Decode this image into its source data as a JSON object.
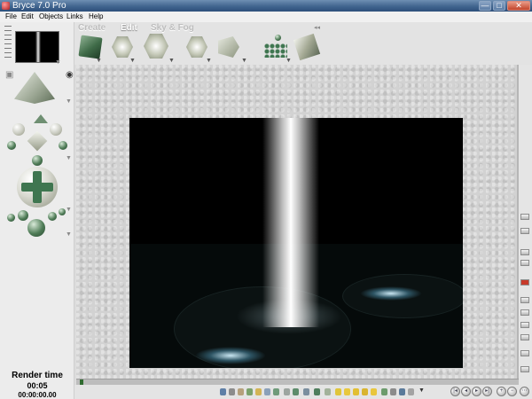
{
  "window": {
    "title": "Bryce 7.0 Pro",
    "buttons": {
      "minimize": "—",
      "maximize": "□",
      "close": "✕"
    }
  },
  "menu": [
    "File",
    "Edit",
    "Objects",
    "Links",
    "Help"
  ],
  "tabs": {
    "create": "Create",
    "edit": "Edit",
    "sky_fog": "Sky & Fog",
    "active": "edit"
  },
  "toolbar_icons": [
    "cube-icon",
    "repair-icon",
    "smooth-icon",
    "scale-icon",
    "align-icon",
    "randomize-icon",
    "materials-icon"
  ],
  "render_status": {
    "label": "Render time",
    "time": "00:05",
    "clock": "00:00:00.00"
  },
  "colors": {
    "accent_green": "#3f7650",
    "beam": "#ffffff",
    "scene_background": "#000000"
  }
}
